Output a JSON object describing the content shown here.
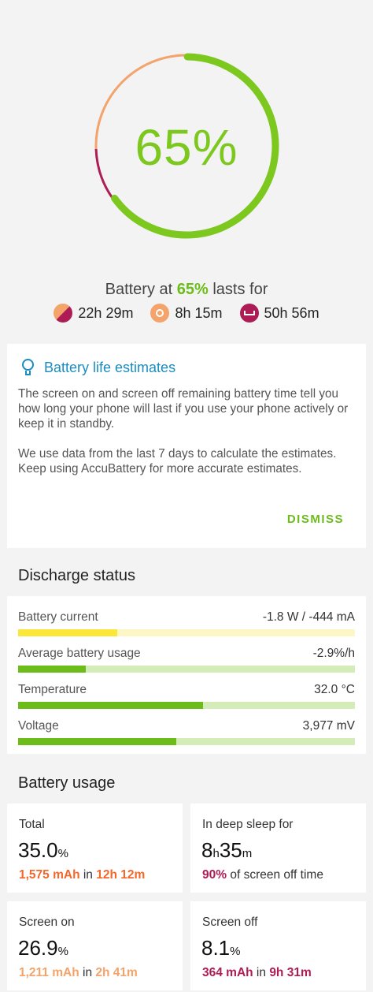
{
  "ring": {
    "percent_text": "65%",
    "charge_fraction": 0.65,
    "colors": {
      "charge": "#7cc81e",
      "screen_on": "#f4a36a",
      "screen_off": "#ad1c55",
      "track": "#e6e6e6"
    }
  },
  "summary": {
    "prefix": "Battery at ",
    "percent": "65%",
    "suffix": " lasts for",
    "estimates": [
      {
        "icon": "mixed-usage-icon",
        "value": "22h 29m"
      },
      {
        "icon": "screen-on-icon",
        "value": "8h 15m"
      },
      {
        "icon": "sleep-icon",
        "value": "50h 56m"
      }
    ]
  },
  "info_card": {
    "title": "Battery life estimates",
    "paragraph1": "The screen on and screen off remaining battery time tell you how long your phone will last if you use your phone actively or keep it in standby.",
    "paragraph2": "We use data from the last 7 days to calculate the estimates. Keep using AccuBattery for more accurate estimates.",
    "dismiss_label": "DISMISS"
  },
  "discharge": {
    "title": "Discharge status",
    "metrics": [
      {
        "label": "Battery current",
        "value": "-1.8 W / -444 mA",
        "level": 0.295,
        "fill": "#fbe739",
        "track": "#fcf7c4"
      },
      {
        "label": "Average battery usage",
        "value": "-2.9%/h",
        "level": 0.2,
        "fill": "#6cbc1a",
        "track": "#d3ecb8"
      },
      {
        "label": "Temperature",
        "value": "32.0 °C",
        "level": 0.55,
        "fill": "#6cbc1a",
        "track": "#d3ecb8"
      },
      {
        "label": "Voltage",
        "value": "3,977 mV",
        "level": 0.47,
        "fill": "#6cbc1a",
        "track": "#d3ecb8"
      }
    ]
  },
  "usage": {
    "title": "Battery usage",
    "total": {
      "label": "Total",
      "big": "35.0",
      "unit": "%",
      "mah": "1,575 mAh",
      "in": " in ",
      "time": "12h 12m"
    },
    "deep_sleep": {
      "label": "In deep sleep for",
      "h": "8",
      "h_unit": "h",
      "m": "35",
      "m_unit": "m",
      "pct": "90%",
      "rest": " of screen off time"
    },
    "screen_on": {
      "label": "Screen on",
      "big": "26.9",
      "unit": "%",
      "mah": "1,211 mAh",
      "in": " in ",
      "time": "2h 41m"
    },
    "screen_off": {
      "label": "Screen off",
      "big": "8.1",
      "unit": "%",
      "mah": "364 mAh",
      "in": " in ",
      "time": "9h 31m"
    }
  }
}
